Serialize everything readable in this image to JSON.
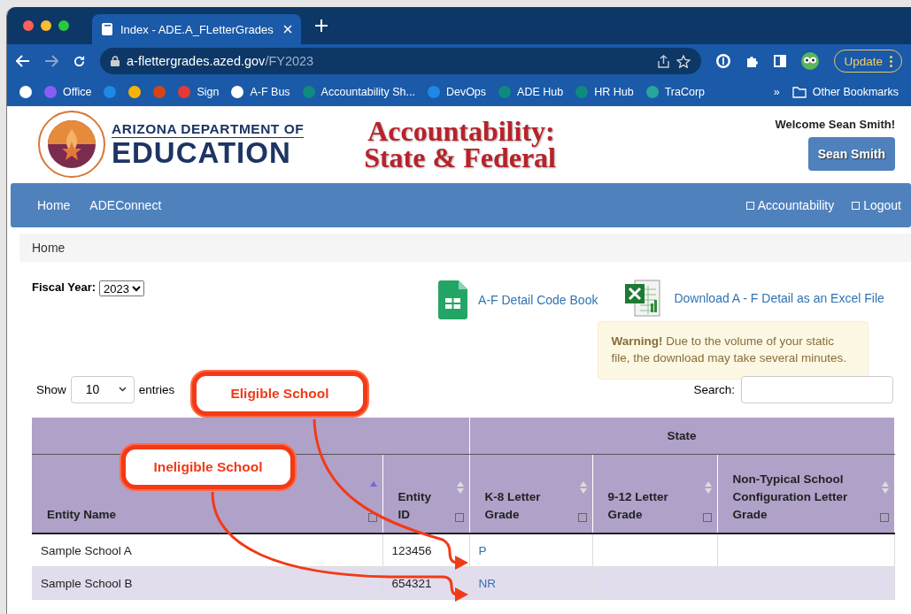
{
  "browser": {
    "tabs": [
      {
        "title": "Index - ADE.A_FLetterGrades",
        "selected": true
      }
    ],
    "url": {
      "host": "a-flettergrades.azed.gov",
      "path": "/FY2023"
    },
    "update_button": "Update",
    "bookmarks": [
      {
        "color": "#ffffff"
      },
      {
        "label": "Office",
        "color": "#8a5cf6"
      },
      {
        "color": "#1e88e5"
      },
      {
        "color": "#f5b400"
      },
      {
        "color": "#d84315"
      },
      {
        "label": "Sign",
        "color": "#e53935"
      },
      {
        "label": "A-F Bus",
        "color": "#ffffff"
      },
      {
        "label": "Accountability Sh...",
        "color": "#0f8a7e"
      },
      {
        "label": "DevOps",
        "color": "#1e88e5"
      },
      {
        "label": "ADE Hub",
        "color": "#0f8a7e"
      },
      {
        "label": "HR Hub",
        "color": "#0f8a7e"
      },
      {
        "label": "TraCorp",
        "color": "#26a69a"
      }
    ],
    "more": "»",
    "other_bookmarks": "Other Bookmarks"
  },
  "header": {
    "logo_line1": "ARIZONA DEPARTMENT OF",
    "logo_line2": "EDUCATION",
    "title_line1": "Accountability:",
    "title_line2": "State & Federal",
    "welcome": "Welcome Sean Smith!",
    "user_button": "Sean Smith"
  },
  "nav": {
    "left": [
      "Home",
      "ADEConnect"
    ],
    "right": [
      "Accountability",
      "Logout"
    ]
  },
  "breadcrumb": "Home",
  "fiscal_year": {
    "label": "Fiscal Year:",
    "value": "2023"
  },
  "links": [
    {
      "kind": "sheets",
      "label": "A-F Detail Code Book"
    },
    {
      "kind": "excel",
      "label": "Download A - F Detail as an Excel File"
    }
  ],
  "warning": "**Warning!** Due to the volume of your static file, the download may take several minutes.",
  "table_controls": {
    "show": "Show",
    "length": "10",
    "entries": "entries",
    "search_label": "Search:"
  },
  "table": {
    "group_header": "State",
    "columns": [
      {
        "label": "Entity Name",
        "sorted": true
      },
      {
        "label": "Entity ID",
        "sorted": false
      },
      {
        "label": "K-8 Letter Grade",
        "sorted": false
      },
      {
        "label": "9-12 Letter Grade",
        "sorted": false
      },
      {
        "label": "Non-Typical School Configuration Letter Grade",
        "sorted": false
      }
    ],
    "rows": [
      [
        "Sample School A",
        "123456",
        "P",
        "",
        ""
      ],
      [
        "Sample School B",
        "654321",
        "NR",
        "",
        ""
      ]
    ]
  },
  "annotations": [
    {
      "label": "Eligible School"
    },
    {
      "label": "Ineligible School"
    }
  ]
}
